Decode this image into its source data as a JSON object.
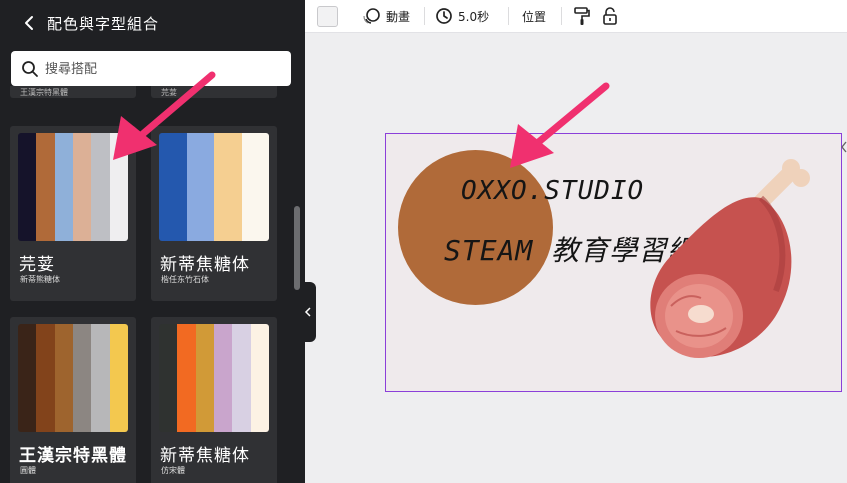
{
  "panel": {
    "title": "配色與字型組合",
    "search_placeholder": "搜尋搭配"
  },
  "top_partial_cards": [
    {
      "subtitle": "王漢宗特黑體"
    },
    {
      "subtitle": "芫荽"
    }
  ],
  "cards": [
    {
      "title": "芫荽",
      "subtitle": "新蒂熊糖体",
      "colors": [
        "#15132a",
        "#b06a39",
        "#8fb0d9",
        "#dcb096",
        "#bebfc4",
        "#efeef0"
      ],
      "bold": false
    },
    {
      "title": "新蒂焦糖体",
      "subtitle": "楷任东竹石体",
      "colors": [
        "#2458ae",
        "#8aaae0",
        "#f5cf91",
        "#fbf7ee"
      ],
      "bold": false
    },
    {
      "title": "王漢宗特黑體",
      "subtitle": "圓體",
      "colors": [
        "#3a2418",
        "#82431b",
        "#9e642e",
        "#8c8682",
        "#b7b7b9",
        "#f3c84f"
      ],
      "bold": true
    },
    {
      "title": "新蒂焦糖体",
      "subtitle": "仿宋體",
      "colors": [
        "#2f3230",
        "#f26a22",
        "#d19a37",
        "#c9a5cc",
        "#d8d0e3",
        "#fcf2e4"
      ],
      "bold": false
    }
  ],
  "toolbar": {
    "animate_label": "動畫",
    "duration_label": "5.0秒",
    "position_label": "位置"
  },
  "canvas": {
    "text_line1": "OXXO.STUDIO",
    "text_line2": "STEAM 教育學習網",
    "circle_color": "#b06a39",
    "selection_color": "#8b3fd9"
  },
  "annotation_color": "#f0306f"
}
